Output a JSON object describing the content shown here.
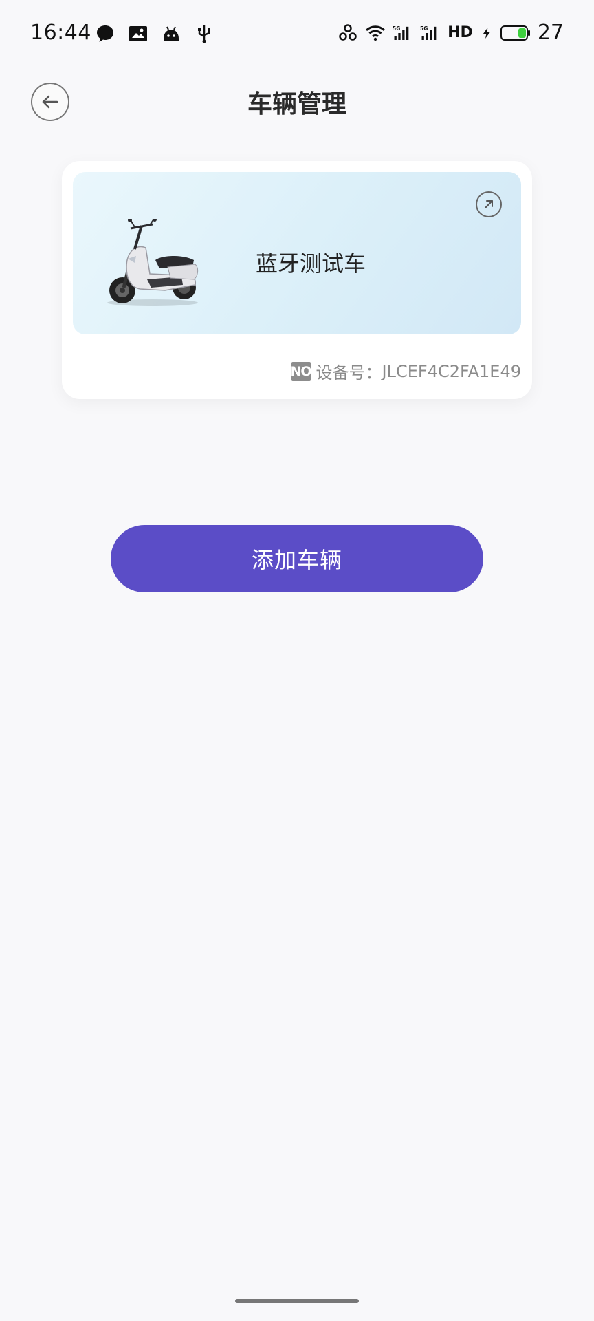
{
  "status_bar": {
    "time": "16:44",
    "left_icons": [
      "chat-bubble-icon",
      "photo-icon",
      "android-icon",
      "usb-icon"
    ],
    "right_icons": [
      "link-icon",
      "wifi-icon",
      "signal-5g-icon",
      "signal-5g-icon",
      "hd-icon",
      "charging-icon",
      "battery-icon"
    ],
    "hd_label": "HD",
    "battery_level": "27"
  },
  "header": {
    "back_icon": "arrow-left-icon",
    "title": "车辆管理"
  },
  "vehicle_card": {
    "name": "蓝牙测试车",
    "open_icon": "arrow-up-right-icon",
    "device_label": "设备号：",
    "device_id": "JLCEF4C2FA1E49",
    "device_icon": "number-icon",
    "device_icon_text": "NO"
  },
  "actions": {
    "add_vehicle_label": "添加车辆"
  },
  "colors": {
    "accent": "#5b4dc7",
    "background": "#f8f8fa",
    "banner_start": "#eaf7fc",
    "banner_end": "#d2e8f6",
    "battery_fill": "#3ecf3e"
  }
}
